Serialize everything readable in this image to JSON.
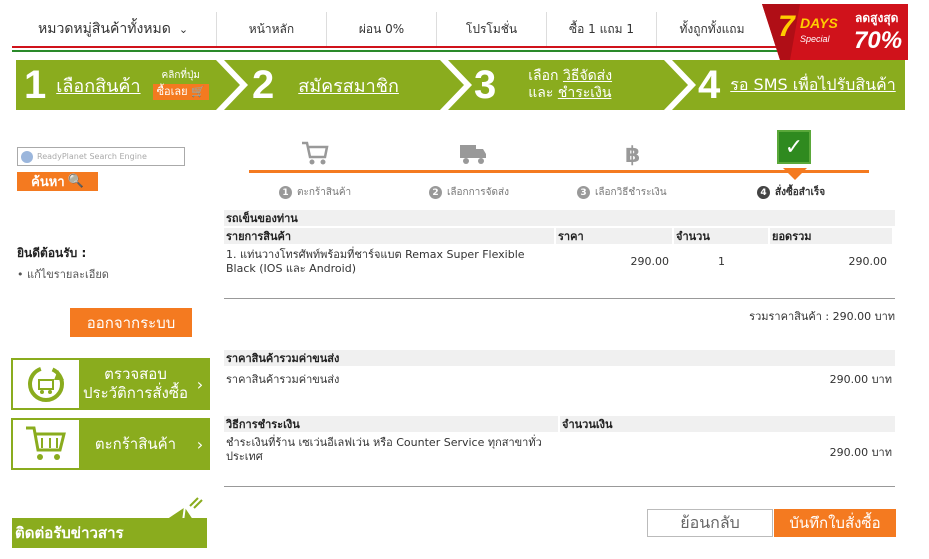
{
  "nav": {
    "category": "หมวดหมู่สินค้าทั้งหมด",
    "items": [
      "หน้าหลัก",
      "ผ่อน 0%",
      "โปรโมชั่น",
      "ซื้อ 1 แถม 1",
      "ทั้งถูกทั้งแถม"
    ]
  },
  "promo": {
    "days": "7DAYS",
    "special": "Special",
    "sale": "ลดสูงสุด",
    "percent": "70%"
  },
  "steps": {
    "s1": {
      "num": "1",
      "label": "เลือกสินค้า",
      "click_hint": "คลิกที่ปุ่ม",
      "click_btn": "ซื้อเลย"
    },
    "s2": {
      "num": "2",
      "label": "สมัครสมาชิก"
    },
    "s3": {
      "num": "3",
      "line1_a": "เลือก",
      "line1_b": "วิธีจัดส่ง",
      "line2_a": "และ",
      "line2_b": "ชำระเงิน"
    },
    "s4": {
      "num": "4",
      "label": "รอ SMS เพื่อไปรับสินค้า"
    }
  },
  "search": {
    "placeholder": "ReadyPlanet Search Engine",
    "button": "ค้นหา"
  },
  "welcome": {
    "title": "ยินดีต้อนรับ :",
    "edit_link": "แก้ไขรายละเอียด"
  },
  "logout": "ออกจากระบบ",
  "side_buttons": {
    "history": "ตรวจสอบ ประวัติการสั่งซื้อ",
    "cart": "ตะกร้าสินค้า"
  },
  "newsletter": "ติดต่อรับข่าวสาร",
  "progress": {
    "step1": "ตะกร้าสินค้า",
    "step2": "เลือกการจัดส่ง",
    "step3": "เลือกวิธีชำระเงิน",
    "step4": "สั่งซื้อสำเร็จ"
  },
  "cart": {
    "title": "รถเข็นของท่าน",
    "col_item": "รายการสินค้า",
    "col_price": "ราคา",
    "col_qty": "จำนวน",
    "col_total": "ยอดรวม",
    "item_line1": "1. แท่นวางโทรศัพท์พร้อมที่ชาร์จแบต Remax Super Flexible",
    "item_line2": "Black (IOS และ Android)",
    "item_price": "290.00",
    "item_qty": "1",
    "item_total": "290.00",
    "subtotal": "รวมราคาสินค้า : 290.00 บาท"
  },
  "shipping": {
    "title": "ราคาสินค้ารวมค่าขนส่ง",
    "label": "ราคาสินค้ารวมค่าขนส่ง",
    "value": "290.00 บาท"
  },
  "payment": {
    "col_method": "วิธีการชำระเงิน",
    "col_amount": "จำนวนเงิน",
    "method_line1": "ชำระเงินที่ร้าน เซเว่นอีเลฟเว่น หรือ Counter Service ทุกสาขาทั่ว",
    "method_line2": "ประเทศ",
    "amount": "290.00 บาท"
  },
  "buttons": {
    "back": "ย้อนกลับ",
    "save": "บันทึกใบสั่งซื้อ"
  },
  "colors": {
    "green": "#8aac1e",
    "orange": "#f47a20",
    "red_stripe": "#d0121b",
    "green_stripe": "#2a8a2a"
  }
}
